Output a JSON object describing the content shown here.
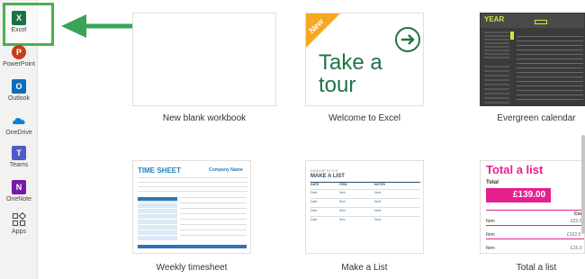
{
  "rail": {
    "apps": [
      {
        "label": "Excel",
        "icon": "excel-icon",
        "color": "#1e7145",
        "letter": "X"
      },
      {
        "label": "PowerPoint",
        "icon": "powerpoint-icon",
        "color": "#c43e1c",
        "letter": "P"
      },
      {
        "label": "Outlook",
        "icon": "outlook-icon",
        "color": "#0f6cbd",
        "letter": "O"
      },
      {
        "label": "OneDrive",
        "icon": "onedrive-icon",
        "color": "#0a84d8",
        "letter": ""
      },
      {
        "label": "Teams",
        "icon": "teams-icon",
        "color": "#5059c9",
        "letter": "T"
      },
      {
        "label": "OneNote",
        "icon": "onenote-icon",
        "color": "#7719aa",
        "letter": "N"
      },
      {
        "label": "Apps",
        "icon": "apps-grid-icon",
        "color": "#555555",
        "letter": ""
      }
    ]
  },
  "templates": [
    {
      "caption": "New blank workbook"
    },
    {
      "caption": "Welcome to Excel",
      "badge": "New",
      "line1": "Take a",
      "line2": "tour"
    },
    {
      "caption": "Evergreen calendar",
      "header": "YEAR"
    },
    {
      "caption": "Weekly timesheet",
      "title": "TIME SHEET",
      "company": "Company Name"
    },
    {
      "caption": "Make a List",
      "kicker": "SIGN-UP STYLE",
      "title": "MAKE A LIST",
      "cols": [
        "DATE",
        "ITEM",
        "NOTES"
      ],
      "rows": [
        [
          "Date",
          "Item",
          "Note"
        ],
        [
          "Date",
          "Item",
          "Note"
        ],
        [
          "Date",
          "Item",
          "Note"
        ],
        [
          "Date",
          "Item",
          "Note"
        ]
      ]
    },
    {
      "caption": "Total a list",
      "title": "Total a list",
      "total_label": "Total",
      "total_value": "£139.00",
      "col2": "Cos",
      "rows": [
        [
          "Item",
          "£22.0"
        ],
        [
          "Item",
          "£102.0"
        ],
        [
          "Item",
          "£15.0"
        ]
      ]
    }
  ],
  "colors": {
    "excel_green": "#1e7145",
    "highlight_green": "#4caf50",
    "tour_green": "#217346",
    "badge_orange": "#f7a823",
    "pink": "#e5208f"
  }
}
